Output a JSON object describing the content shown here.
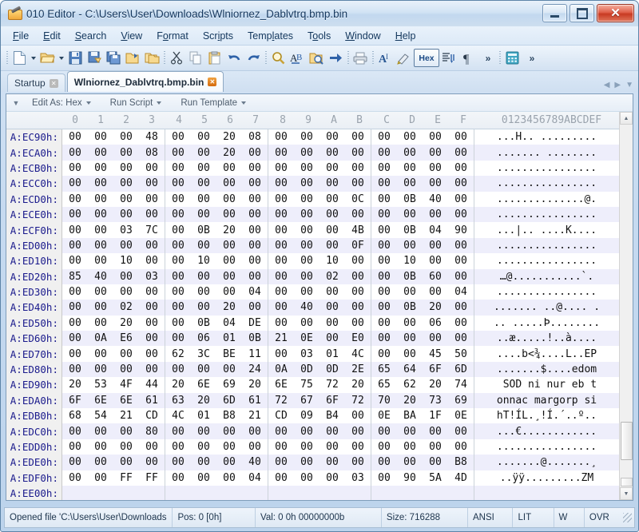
{
  "window": {
    "title": "010 Editor - C:\\Users\\User\\Downloads\\Wlniornez_Dablvtrq.bmp.bin",
    "icon": "app-icon",
    "minimize_label": "–",
    "maximize_label": "□",
    "close_label": "✕"
  },
  "menu": [
    {
      "label": "File"
    },
    {
      "label": "Edit"
    },
    {
      "label": "Search"
    },
    {
      "label": "View"
    },
    {
      "label": "Format"
    },
    {
      "label": "Scripts"
    },
    {
      "label": "Templates"
    },
    {
      "label": "Tools"
    },
    {
      "label": "Window"
    },
    {
      "label": "Help"
    }
  ],
  "toolbar": {
    "hex_button_label": "Hex",
    "overflow_label": "»",
    "items": [
      "new-file-icon",
      "new-file-dropdown",
      "open-file-icon",
      "open-file-dropdown",
      "save-icon",
      "save-as-icon",
      "save-all-icon",
      "open-folder-icon",
      "open-recent-icon",
      "cut-icon",
      "copy-icon",
      "paste-icon",
      "undo-icon",
      "redo-icon",
      "find-icon",
      "replace-icon",
      "find-in-files-icon",
      "goto-icon",
      "print-icon",
      "font-icon",
      "highlight-icon",
      "hex-toggle-icon",
      "compare-icon",
      "paragraph-icon",
      "calculator-icon"
    ]
  },
  "tabs": [
    {
      "label": "Startup",
      "active": false
    },
    {
      "label": "Wlniornez_Dablvtrq.bmp.bin",
      "active": true
    }
  ],
  "editbar": {
    "edit_as": "Edit As: Hex",
    "run_script": "Run Script",
    "run_template": "Run Template"
  },
  "grid": {
    "address_header": "",
    "columns": [
      "0",
      "1",
      "2",
      "3",
      "4",
      "5",
      "6",
      "7",
      "8",
      "9",
      "A",
      "B",
      "C",
      "D",
      "E",
      "F"
    ],
    "ascii_header": "0123456789ABCDEF",
    "rows": [
      {
        "addr": "A:EC90h:",
        "bytes": [
          "00",
          "00",
          "00",
          "48",
          "00",
          "00",
          "20",
          "08",
          "00",
          "00",
          "00",
          "00",
          "00",
          "00",
          "00",
          "00"
        ],
        "ascii": "...H.. ........."
      },
      {
        "addr": "A:ECA0h:",
        "bytes": [
          "00",
          "00",
          "00",
          "08",
          "00",
          "00",
          "20",
          "00",
          "00",
          "00",
          "00",
          "00",
          "00",
          "00",
          "00",
          "00"
        ],
        "ascii": "....... ........"
      },
      {
        "addr": "A:ECB0h:",
        "bytes": [
          "00",
          "00",
          "00",
          "00",
          "00",
          "00",
          "00",
          "00",
          "00",
          "00",
          "00",
          "00",
          "00",
          "00",
          "00",
          "00"
        ],
        "ascii": "................"
      },
      {
        "addr": "A:ECC0h:",
        "bytes": [
          "00",
          "00",
          "00",
          "00",
          "00",
          "00",
          "00",
          "00",
          "00",
          "00",
          "00",
          "00",
          "00",
          "00",
          "00",
          "00"
        ],
        "ascii": "................"
      },
      {
        "addr": "A:ECD0h:",
        "bytes": [
          "00",
          "00",
          "00",
          "00",
          "00",
          "00",
          "00",
          "00",
          "00",
          "00",
          "00",
          "0C",
          "00",
          "0B",
          "40",
          "00"
        ],
        "ascii": "..............@."
      },
      {
        "addr": "A:ECE0h:",
        "bytes": [
          "00",
          "00",
          "00",
          "00",
          "00",
          "00",
          "00",
          "00",
          "00",
          "00",
          "00",
          "00",
          "00",
          "00",
          "00",
          "00"
        ],
        "ascii": "................"
      },
      {
        "addr": "A:ECF0h:",
        "bytes": [
          "00",
          "00",
          "03",
          "7C",
          "00",
          "0B",
          "20",
          "00",
          "00",
          "00",
          "00",
          "4B",
          "00",
          "0B",
          "04",
          "90"
        ],
        "ascii": "...|.. ....K...."
      },
      {
        "addr": "A:ED00h:",
        "bytes": [
          "00",
          "00",
          "00",
          "00",
          "00",
          "00",
          "00",
          "00",
          "00",
          "00",
          "00",
          "0F",
          "00",
          "00",
          "00",
          "00"
        ],
        "ascii": "................"
      },
      {
        "addr": "A:ED10h:",
        "bytes": [
          "00",
          "00",
          "10",
          "00",
          "00",
          "10",
          "00",
          "00",
          "00",
          "00",
          "10",
          "00",
          "00",
          "10",
          "00",
          "00"
        ],
        "ascii": "................"
      },
      {
        "addr": "A:ED20h:",
        "bytes": [
          "85",
          "40",
          "00",
          "03",
          "00",
          "00",
          "00",
          "00",
          "00",
          "00",
          "02",
          "00",
          "00",
          "0B",
          "60",
          "00"
        ],
        "ascii": "…@...........`."
      },
      {
        "addr": "A:ED30h:",
        "bytes": [
          "00",
          "00",
          "00",
          "00",
          "00",
          "00",
          "00",
          "04",
          "00",
          "00",
          "00",
          "00",
          "00",
          "00",
          "00",
          "04"
        ],
        "ascii": "................"
      },
      {
        "addr": "A:ED40h:",
        "bytes": [
          "00",
          "00",
          "02",
          "00",
          "00",
          "00",
          "20",
          "00",
          "00",
          "40",
          "00",
          "00",
          "00",
          "0B",
          "20",
          "00"
        ],
        "ascii": "....... ..@.... ."
      },
      {
        "addr": "A:ED50h:",
        "bytes": [
          "00",
          "00",
          "20",
          "00",
          "00",
          "0B",
          "04",
          "DE",
          "00",
          "00",
          "00",
          "00",
          "00",
          "00",
          "06",
          "00"
        ],
        "ascii": ".. .....Þ........"
      },
      {
        "addr": "A:ED60h:",
        "bytes": [
          "00",
          "0A",
          "E6",
          "00",
          "00",
          "06",
          "01",
          "0B",
          "21",
          "0E",
          "00",
          "E0",
          "00",
          "00",
          "00",
          "00"
        ],
        "ascii": "..æ.....!..à...."
      },
      {
        "addr": "A:ED70h:",
        "bytes": [
          "00",
          "00",
          "00",
          "00",
          "62",
          "3C",
          "BE",
          "11",
          "00",
          "03",
          "01",
          "4C",
          "00",
          "00",
          "45",
          "50"
        ],
        "ascii": "....b<¾....L..EP"
      },
      {
        "addr": "A:ED80h:",
        "bytes": [
          "00",
          "00",
          "00",
          "00",
          "00",
          "00",
          "00",
          "24",
          "0A",
          "0D",
          "0D",
          "2E",
          "65",
          "64",
          "6F",
          "6D"
        ],
        "ascii": ".......$....edom"
      },
      {
        "addr": "A:ED90h:",
        "bytes": [
          "20",
          "53",
          "4F",
          "44",
          "20",
          "6E",
          "69",
          "20",
          "6E",
          "75",
          "72",
          "20",
          "65",
          "62",
          "20",
          "74"
        ],
        "ascii": " SOD ni nur eb t"
      },
      {
        "addr": "A:EDA0h:",
        "bytes": [
          "6F",
          "6E",
          "6E",
          "61",
          "63",
          "20",
          "6D",
          "61",
          "72",
          "67",
          "6F",
          "72",
          "70",
          "20",
          "73",
          "69"
        ],
        "ascii": "onnac margorp si"
      },
      {
        "addr": "A:EDB0h:",
        "bytes": [
          "68",
          "54",
          "21",
          "CD",
          "4C",
          "01",
          "B8",
          "21",
          "CD",
          "09",
          "B4",
          "00",
          "0E",
          "BA",
          "1F",
          "0E"
        ],
        "ascii": "hT!ÍL.¸!Í.´..º.."
      },
      {
        "addr": "A:EDC0h:",
        "bytes": [
          "00",
          "00",
          "00",
          "80",
          "00",
          "00",
          "00",
          "00",
          "00",
          "00",
          "00",
          "00",
          "00",
          "00",
          "00",
          "00"
        ],
        "ascii": "...€............"
      },
      {
        "addr": "A:EDD0h:",
        "bytes": [
          "00",
          "00",
          "00",
          "00",
          "00",
          "00",
          "00",
          "00",
          "00",
          "00",
          "00",
          "00",
          "00",
          "00",
          "00",
          "00"
        ],
        "ascii": "................"
      },
      {
        "addr": "A:EDE0h:",
        "bytes": [
          "00",
          "00",
          "00",
          "00",
          "00",
          "00",
          "00",
          "40",
          "00",
          "00",
          "00",
          "00",
          "00",
          "00",
          "00",
          "B8"
        ],
        "ascii": ".......@.......¸"
      },
      {
        "addr": "A:EDF0h:",
        "bytes": [
          "00",
          "00",
          "FF",
          "FF",
          "00",
          "00",
          "00",
          "04",
          "00",
          "00",
          "00",
          "03",
          "00",
          "90",
          "5A",
          "4D"
        ],
        "ascii": "..ÿÿ.........ZM"
      },
      {
        "addr": "A:EE00h:",
        "bytes": [
          "",
          "",
          "",
          "",
          "",
          "",
          "",
          "",
          "",
          "",
          "",
          "",
          "",
          "",
          "",
          ""
        ],
        "ascii": ""
      }
    ]
  },
  "scrollbar": {
    "up_arrow": "▲",
    "down_arrow": "▼"
  },
  "status": {
    "message": "Opened file 'C:\\Users\\User\\Downloads",
    "pos": "Pos: 0 [0h]",
    "val": "Val: 0 0h 00000000b",
    "size": "Size: 716288",
    "encoding": "ANSI",
    "endian": "LIT",
    "mode_w": "W",
    "mode_ovr": "OVR"
  },
  "colors": {
    "address_text": "#1a1a8c",
    "accent": "#1b4a86",
    "alt_row": "#eeeefb",
    "title_text": "#14375e"
  }
}
